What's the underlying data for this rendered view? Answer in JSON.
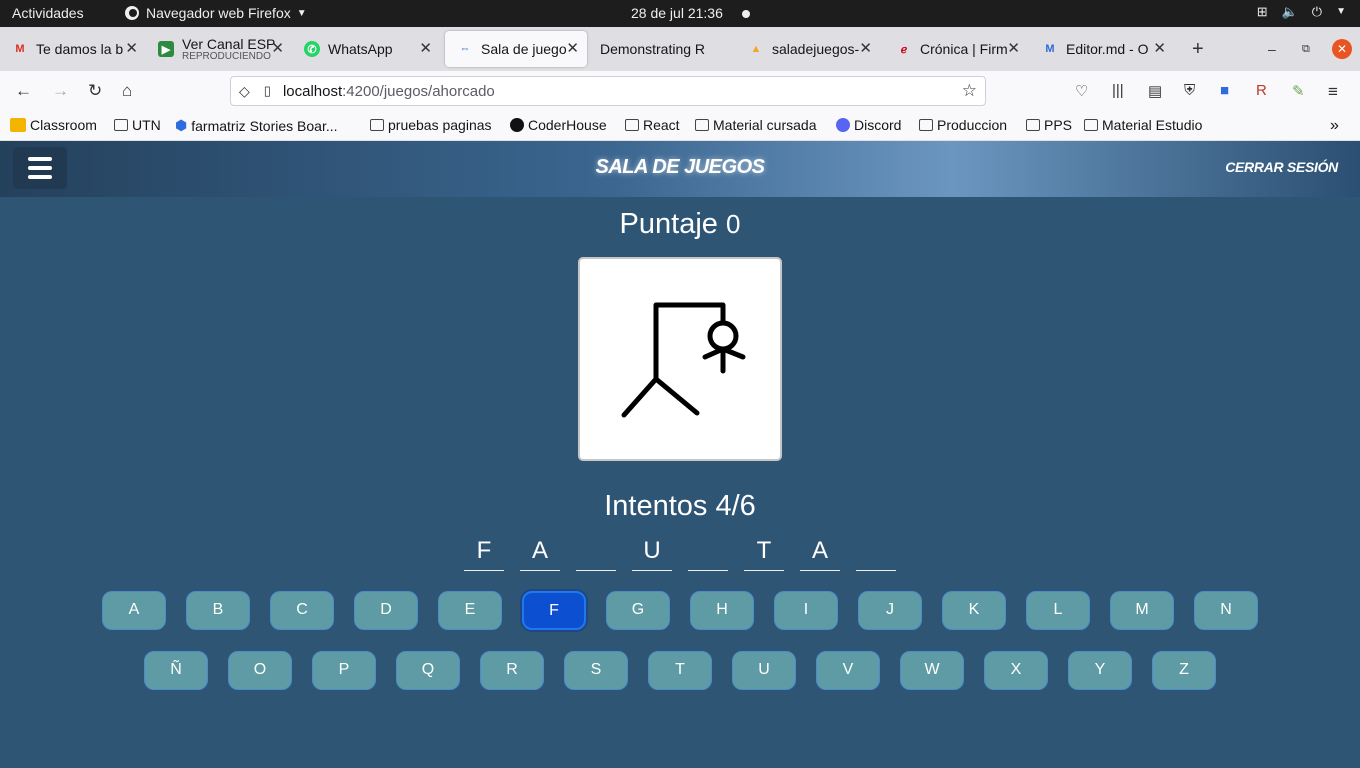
{
  "system": {
    "activities": "Actividades",
    "app_name": "Navegador web Firefox",
    "clock": "28 de jul  21:36"
  },
  "tabs": [
    {
      "label": "Te damos la b",
      "icon": "gmail-icon"
    },
    {
      "label": "Ver Canal ESP",
      "sub": "REPRODUCIENDO",
      "icon": "play-icon"
    },
    {
      "label": "WhatsApp",
      "icon": "whatsapp-icon"
    },
    {
      "label": "Sala de juego",
      "icon": "game-icon",
      "active": true
    },
    {
      "label": "Demonstrating R",
      "icon": ""
    },
    {
      "label": "saladejuegos-",
      "icon": "firebase-icon"
    },
    {
      "label": "Crónica | Firm",
      "icon": "cronica-icon"
    },
    {
      "label": "Editor.md - O",
      "icon": "editor-icon"
    }
  ],
  "url": {
    "host": "localhost",
    "path": ":4200/juegos/ahorcado"
  },
  "bookmarks": [
    {
      "label": "Classroom",
      "icon": "classroom-icon"
    },
    {
      "label": "UTN",
      "icon": "folder-icon"
    },
    {
      "label": "farmatriz Stories Boar...",
      "icon": "trello-icon"
    },
    {
      "label": "pruebas paginas",
      "icon": "folder-icon"
    },
    {
      "label": "CoderHouse",
      "icon": "coderhouse-icon"
    },
    {
      "label": "React",
      "icon": "folder-icon"
    },
    {
      "label": "Material cursada",
      "icon": "folder-icon"
    },
    {
      "label": "Discord",
      "icon": "discord-icon"
    },
    {
      "label": "Produccion",
      "icon": "folder-icon"
    },
    {
      "label": "PPS",
      "icon": "folder-icon"
    },
    {
      "label": "Material Estudio",
      "icon": "folder-icon"
    }
  ],
  "header": {
    "title": "SALA DE JUEGOS",
    "logout": "CERRAR SESIÓN"
  },
  "game": {
    "score_label": "Puntaje",
    "score": "0",
    "tries_label": "Intentos",
    "tries": "4/6",
    "word": [
      "F",
      "A",
      "",
      "U",
      "",
      "T",
      "A",
      ""
    ],
    "selected_key": "F",
    "keys_row1": [
      "A",
      "B",
      "C",
      "D",
      "E",
      "F",
      "G",
      "H",
      "I",
      "J",
      "K",
      "L",
      "M",
      "N"
    ],
    "keys_row2": [
      "Ñ",
      "O",
      "P",
      "Q",
      "R",
      "S",
      "T",
      "U",
      "V",
      "W",
      "X",
      "Y",
      "Z"
    ]
  },
  "colors": {
    "background": "#2f5575",
    "key": "#5f9ba4",
    "key_selected": "#0d4fd1"
  }
}
